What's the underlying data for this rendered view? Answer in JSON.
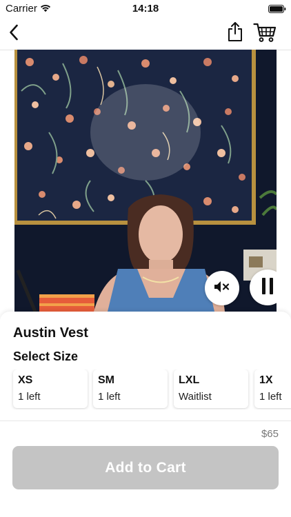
{
  "status_bar": {
    "carrier": "Carrier",
    "time": "14:18",
    "icons": [
      "wifi-icon",
      "battery-icon"
    ]
  },
  "nav": {
    "icons": [
      "chevron-left-icon",
      "share-icon",
      "cart-icon"
    ]
  },
  "video": {
    "controls": [
      "mute-icon",
      "pause-icon"
    ]
  },
  "product": {
    "title": "Austin Vest",
    "select_size_label": "Select Size",
    "sizes": [
      {
        "name": "XS",
        "status": "1 left"
      },
      {
        "name": "SM",
        "status": "1 left"
      },
      {
        "name": "LXL",
        "status": "Waitlist"
      },
      {
        "name": "1X",
        "status": "1 left"
      }
    ]
  },
  "footer": {
    "price": "$65",
    "add_to_cart_label": "Add to Cart",
    "add_to_cart_enabled": false
  },
  "colors": {
    "button_disabled": "#c4c4c4",
    "price_text": "#777777",
    "wallpaper": "#1b2642"
  }
}
